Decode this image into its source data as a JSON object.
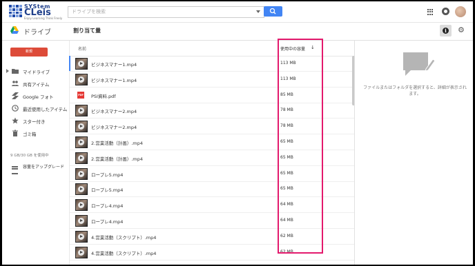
{
  "brand": {
    "top": "SYStem",
    "main": "CLeis",
    "tagline": "Enjoy Learning Think Freely"
  },
  "search": {
    "placeholder": "ドライブを検索"
  },
  "app": {
    "title": "ドライブ",
    "page_title": "割り当て量"
  },
  "sidebar": {
    "new_label": "新規",
    "items": [
      {
        "label": "マイドライブ",
        "icon": "folder-icon"
      },
      {
        "label": "共有アイテム",
        "icon": "people-icon"
      },
      {
        "label": "Google フォト",
        "icon": "photos-icon"
      },
      {
        "label": "最近使用したアイテム",
        "icon": "clock-icon"
      },
      {
        "label": "スター付き",
        "icon": "star-icon"
      },
      {
        "label": "ゴミ箱",
        "icon": "trash-icon"
      }
    ],
    "storage": "9 GB/30 GB を使用中",
    "upgrade_label": "容量をアップグレード"
  },
  "list": {
    "header_name": "名前",
    "header_size": "使用中の容量",
    "rows": [
      {
        "name": "ビジネスマナー1.mp4",
        "size": "113 MB",
        "type": "video"
      },
      {
        "name": "ビジネスマナー1.mp4",
        "size": "113 MB",
        "type": "video"
      },
      {
        "name": "PSI資料.pdf",
        "size": "85 MB",
        "type": "pdf"
      },
      {
        "name": "ビジネスマナー2.mp4",
        "size": "78 MB",
        "type": "video"
      },
      {
        "name": "ビジネスマナー2.mp4",
        "size": "78 MB",
        "type": "video"
      },
      {
        "name": "2.営業活動（計画）.mp4",
        "size": "65 MB",
        "type": "video"
      },
      {
        "name": "2.営業活動（計画）.mp4",
        "size": "65 MB",
        "type": "video"
      },
      {
        "name": "ロープレ5.mp4",
        "size": "65 MB",
        "type": "video"
      },
      {
        "name": "ロープレ5.mp4",
        "size": "65 MB",
        "type": "video"
      },
      {
        "name": "ロープレ4.mp4",
        "size": "64 MB",
        "type": "video"
      },
      {
        "name": "ロープレ4.mp4",
        "size": "64 MB",
        "type": "video"
      },
      {
        "name": "4.営業活動（スクリプト）.mp4",
        "size": "62 MB",
        "type": "video"
      },
      {
        "name": "4.営業活動（スクリプト）.mp4",
        "size": "62 MB",
        "type": "video"
      }
    ]
  },
  "details": {
    "empty_text": "ファイルまたはフォルダを選択すると、詳細が表示されます。"
  },
  "colors": {
    "accent": "#4285f4",
    "new_button": "#dd4b39",
    "highlight": "#e3186c"
  }
}
